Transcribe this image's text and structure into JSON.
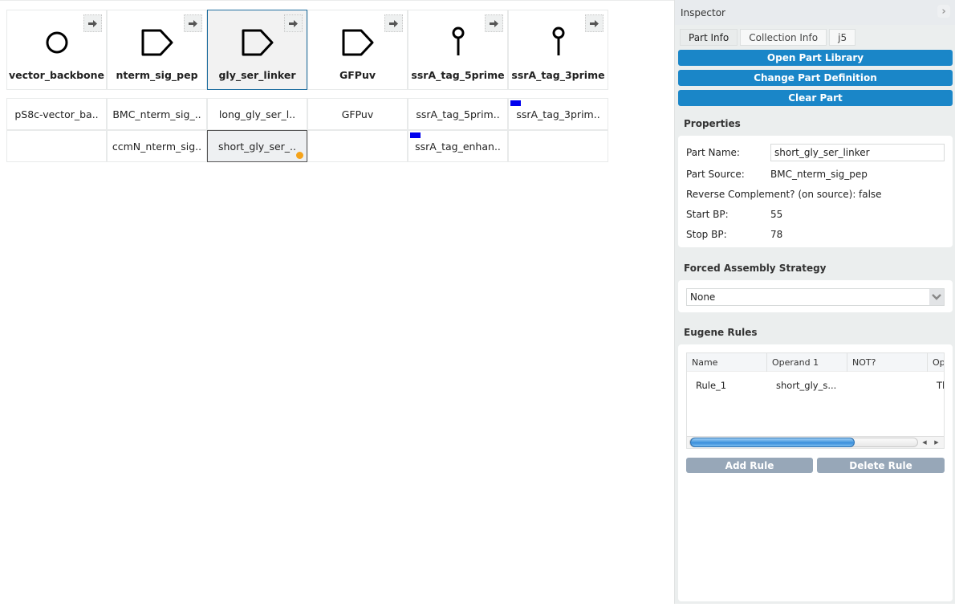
{
  "canvas": {
    "bins": [
      {
        "name": "vector_backbone",
        "glyph": "circle-glyph",
        "selected": false
      },
      {
        "name": "nterm_sig_pep",
        "glyph": "cds-glyph",
        "selected": false
      },
      {
        "name": "gly_ser_linker",
        "glyph": "cds-glyph",
        "selected": true
      },
      {
        "name": "GFPuv",
        "glyph": "cds-glyph",
        "selected": false
      },
      {
        "name": "ssrA_tag_5prime",
        "glyph": "lollipop-glyph",
        "selected": false
      },
      {
        "name": "ssrA_tag_3prime",
        "glyph": "lollipop-glyph",
        "selected": false
      }
    ],
    "rows": [
      [
        {
          "text": "pS8c-vector_ba..",
          "flag": false,
          "dot": false,
          "selected": false
        },
        {
          "text": "BMC_nterm_sig_..",
          "flag": false,
          "dot": false,
          "selected": false
        },
        {
          "text": "long_gly_ser_l..",
          "flag": false,
          "dot": false,
          "selected": false
        },
        {
          "text": "GFPuv",
          "flag": false,
          "dot": false,
          "selected": false
        },
        {
          "text": "ssrA_tag_5prim..",
          "flag": false,
          "dot": false,
          "selected": false
        },
        {
          "text": "ssrA_tag_3prim..",
          "flag": true,
          "dot": false,
          "selected": false
        }
      ],
      [
        {
          "text": "",
          "flag": false,
          "dot": false,
          "selected": false
        },
        {
          "text": "ccmN_nterm_sig..",
          "flag": false,
          "dot": false,
          "selected": false
        },
        {
          "text": "short_gly_ser_..",
          "flag": false,
          "dot": true,
          "selected": true
        },
        {
          "text": "",
          "flag": false,
          "dot": false,
          "selected": false
        },
        {
          "text": "ssrA_tag_enhan..",
          "flag": true,
          "dot": false,
          "selected": false
        },
        {
          "text": "",
          "flag": false,
          "dot": false,
          "selected": false
        }
      ]
    ],
    "colors": {
      "flag": "#0000ee",
      "dot": "#f5a31a",
      "selection_border": "#1f6ea0"
    }
  },
  "inspector": {
    "title": "Inspector",
    "tabs": [
      "Part Info",
      "Collection Info",
      "j5"
    ],
    "active_tab": "Part Info",
    "buttons": {
      "open_library": "Open Part Library",
      "change_definition": "Change Part Definition",
      "clear_part": "Clear Part"
    },
    "properties": {
      "title": "Properties",
      "part_name_label": "Part Name:",
      "part_name_value": "short_gly_ser_linker",
      "part_source_label": "Part Source:",
      "part_source_value": "BMC_nterm_sig_pep",
      "revcomp_label": "Reverse Complement? (on source):",
      "revcomp_value": "false",
      "start_label": "Start BP:",
      "start_value": "55",
      "stop_label": "Stop BP:",
      "stop_value": "78"
    },
    "assembly": {
      "title": "Forced Assembly Strategy",
      "selected": "None"
    },
    "eugene": {
      "title": "Eugene Rules",
      "columns": [
        "Name",
        "Operand 1",
        "NOT?",
        "Op"
      ],
      "rows": [
        {
          "name": "Rule_1",
          "operand1": "short_gly_s...",
          "not": "",
          "op": "Tl"
        }
      ],
      "add_rule": "Add Rule",
      "delete_rule": "Delete Rule"
    },
    "accent_color": "#1a86c8"
  }
}
